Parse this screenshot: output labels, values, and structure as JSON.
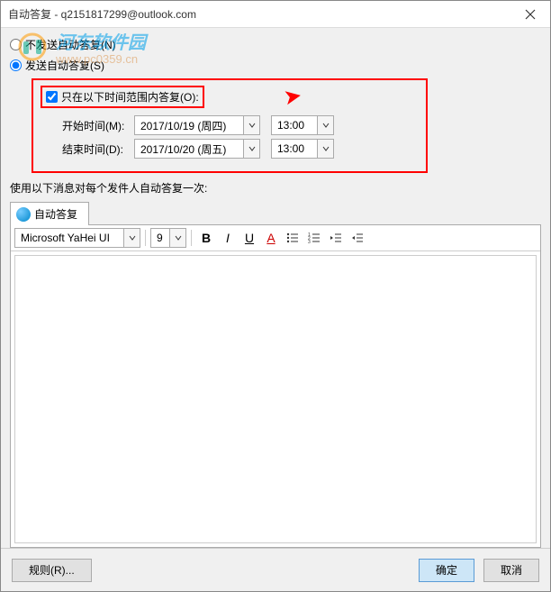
{
  "titlebar": {
    "title": "自动答复 - q2151817299@outlook.com"
  },
  "radios": {
    "no_send": "不发送自动答复(N)",
    "send": "发送自动答复(S)"
  },
  "watermark": {
    "main": "河东软件园",
    "url": "www.pc0359.cn"
  },
  "checkbox": {
    "label": "只在以下时间范围内答复(O):"
  },
  "time": {
    "start_label": "开始时间(M):",
    "start_date": "2017/10/19 (周四)",
    "start_time": "13:00",
    "end_label": "结束时间(D):",
    "end_date": "2017/10/20 (周五)",
    "end_time": "13:00"
  },
  "instruction": "使用以下消息对每个发件人自动答复一次:",
  "tab": {
    "label": "自动答复"
  },
  "toolbar": {
    "font_name": "Microsoft YaHei UI",
    "font_size": "9",
    "bold": "B",
    "italic": "I",
    "underline": "U",
    "fontcolor": "A"
  },
  "footer": {
    "rules": "规则(R)...",
    "ok": "确定",
    "cancel": "取消"
  }
}
